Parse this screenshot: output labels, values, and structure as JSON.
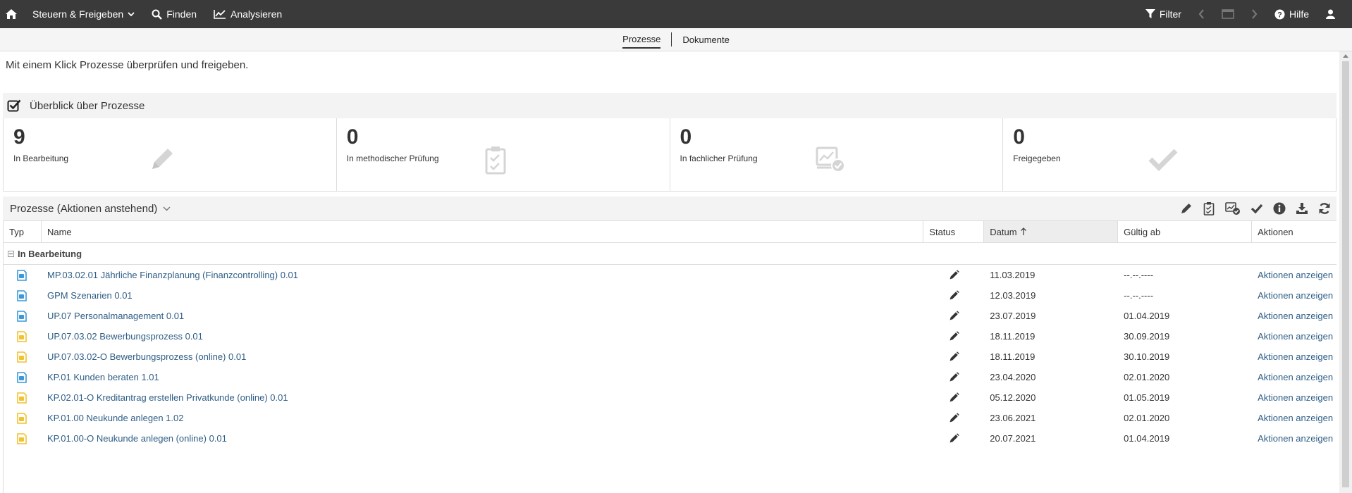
{
  "topbar": {
    "home_icon": "home-icon",
    "nav": [
      {
        "label": "Steuern & Freigeben",
        "icon": "chevron-down-icon"
      },
      {
        "label": "Finden",
        "icon": "search-icon"
      },
      {
        "label": "Analysieren",
        "icon": "chart-line-icon"
      }
    ],
    "filter_label": "Filter",
    "help_label": "Hilfe"
  },
  "subnav": {
    "tabs": [
      {
        "label": "Prozesse",
        "active": true
      },
      {
        "label": "Dokumente",
        "active": false
      }
    ]
  },
  "intro_text": "Mit einem Klick Prozesse überprüfen und freigeben.",
  "overview": {
    "title": "Überblick über Prozesse",
    "cards": [
      {
        "value": "9",
        "label": "In Bearbeitung",
        "icon": "pencil-icon"
      },
      {
        "value": "0",
        "label": "In methodischer Prüfung",
        "icon": "clipboard-check-icon"
      },
      {
        "value": "0",
        "label": "In fachlicher Prüfung",
        "icon": "chart-check-icon"
      },
      {
        "value": "0",
        "label": "Freigegeben",
        "icon": "checkmark-icon"
      }
    ]
  },
  "table": {
    "title": "Prozesse (Aktionen anstehend)",
    "columns": {
      "typ": "Typ",
      "name": "Name",
      "status": "Status",
      "datum": "Datum",
      "gueltig": "Gültig ab",
      "aktionen": "Aktionen"
    },
    "group": "In Bearbeitung",
    "rows": [
      {
        "type": "blue",
        "name": "MP.03.02.01 Jährliche Finanzplanung (Finanzcontrolling) 0.01",
        "datum": "11.03.2019",
        "gueltig": "--.--.----",
        "aktion": "Aktionen anzeigen"
      },
      {
        "type": "blue",
        "name": "GPM Szenarien 0.01",
        "datum": "12.03.2019",
        "gueltig": "--.--.----",
        "aktion": "Aktionen anzeigen"
      },
      {
        "type": "blue",
        "name": "UP.07 Personalmanagement 0.01",
        "datum": "23.07.2019",
        "gueltig": "01.04.2019",
        "aktion": "Aktionen anzeigen"
      },
      {
        "type": "yellow",
        "name": "UP.07.03.02 Bewerbungsprozess 0.01",
        "datum": "18.11.2019",
        "gueltig": "30.09.2019",
        "aktion": "Aktionen anzeigen"
      },
      {
        "type": "yellow",
        "name": "UP.07.03.02-O Bewerbungsprozess (online) 0.01",
        "datum": "18.11.2019",
        "gueltig": "30.10.2019",
        "aktion": "Aktionen anzeigen"
      },
      {
        "type": "blue",
        "name": "KP.01 Kunden beraten 1.01",
        "datum": "23.04.2020",
        "gueltig": "02.01.2020",
        "aktion": "Aktionen anzeigen"
      },
      {
        "type": "yellow",
        "name": "KP.02.01-O Kreditantrag erstellen Privatkunde (online) 0.01",
        "datum": "05.12.2020",
        "gueltig": "01.05.2019",
        "aktion": "Aktionen anzeigen"
      },
      {
        "type": "yellow",
        "name": "KP.01.00 Neukunde anlegen 1.02",
        "datum": "23.06.2021",
        "gueltig": "02.01.2020",
        "aktion": "Aktionen anzeigen"
      },
      {
        "type": "yellow",
        "name": "KP.01.00-O Neukunde anlegen (online) 0.01",
        "datum": "20.07.2021",
        "gueltig": "01.04.2019",
        "aktion": "Aktionen anzeigen"
      }
    ]
  },
  "colors": {
    "topbar_bg": "#3a3a3a",
    "link": "#2e5d86",
    "type_blue": "#3a9ad9",
    "type_yellow": "#f2c230"
  }
}
